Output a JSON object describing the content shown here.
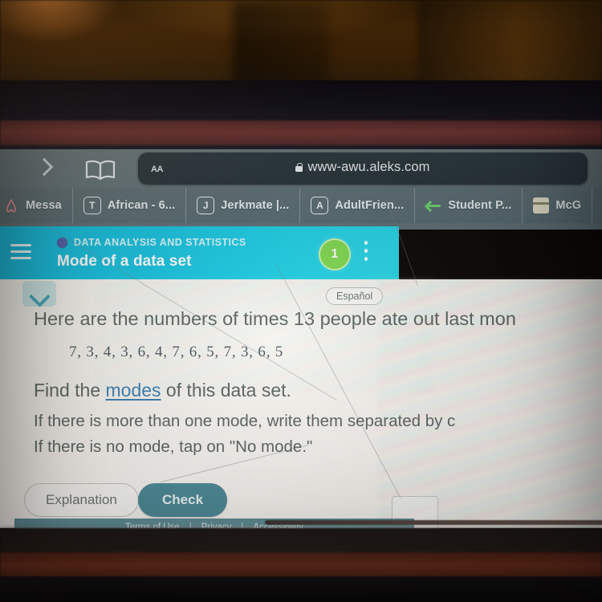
{
  "browser": {
    "forward_icon": "chevron-right-icon",
    "bookmarks_icon": "book-icon",
    "text_size_label": "AA",
    "lock_icon": "lock-icon",
    "url": "www-awu.aleks.com",
    "tabs": [
      {
        "favicon": "airbnb-icon",
        "label": "Messa",
        "type": "airbnb"
      },
      {
        "favicon": "letter-t-icon",
        "label": "African - 6...",
        "type": "letter",
        "letter": "T"
      },
      {
        "favicon": "letter-j-icon",
        "label": "Jerkmate |...",
        "type": "letter",
        "letter": "J"
      },
      {
        "favicon": "letter-a-icon",
        "label": "AdultFrien...",
        "type": "letter",
        "letter": "A"
      },
      {
        "favicon": "green-arrow-icon",
        "label": "Student P...",
        "type": "arrow"
      },
      {
        "favicon": "mcgraw-hill-icon",
        "label": "McG",
        "type": "mcg"
      }
    ]
  },
  "app_header": {
    "menu_icon": "hamburger-menu-icon",
    "category_dot": "purple-dot-icon",
    "category": "DATA ANALYSIS AND STATISTICS",
    "title": "Mode of a data set",
    "progress_badge": "1",
    "overflow_icon": "kebab-menu-icon",
    "accent_color": "#16c4e0",
    "badge_color": "#7fd84f"
  },
  "content": {
    "collapse_icon": "chevron-down-icon",
    "language_button": "Español",
    "prompt": "Here are the numbers of times 13 people ate out last mon",
    "data_values": "7, 3, 4, 3, 6, 4, 7, 6, 5, 7, 3, 6, 5",
    "question_prefix": "Find the ",
    "question_link": "modes",
    "question_suffix": " of this data set.",
    "instruction_1": "If there is more than one mode, write them separated by c",
    "instruction_2": "If there is no mode, tap on \"No mode.\"",
    "link_color": "#3b7fb5"
  },
  "actions": {
    "explanation_label": "Explanation",
    "check_label": "Check",
    "check_color": "#4d8b98"
  },
  "footer": {
    "terms": "Terms of Use",
    "separator": "|",
    "privacy": "Privacy",
    "accessibility": "Accessibility"
  }
}
